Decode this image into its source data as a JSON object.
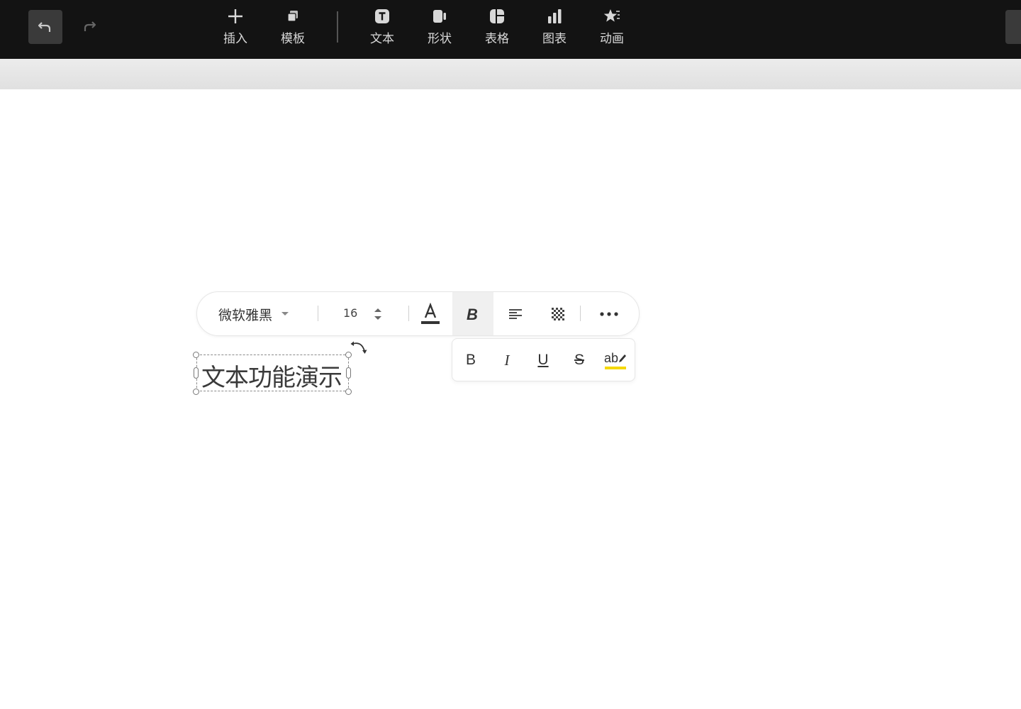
{
  "toolbar": {
    "undo_icon": "undo-arrow-icon",
    "redo_icon": "redo-arrow-icon",
    "tools": [
      {
        "label": "插入",
        "icon": "plus-icon"
      },
      {
        "label": "模板",
        "icon": "template-icon"
      },
      {
        "label": "文本",
        "icon": "text-box-icon"
      },
      {
        "label": "形状",
        "icon": "shape-icon"
      },
      {
        "label": "表格",
        "icon": "table-icon"
      },
      {
        "label": "图表",
        "icon": "bar-chart-icon"
      },
      {
        "label": "动画",
        "icon": "star-animation-icon"
      }
    ]
  },
  "format_bar": {
    "font_family": "微软雅黑",
    "font_size": "16",
    "font_color": "#333333",
    "buttons": [
      "font-color-icon",
      "bold-icon",
      "align-left-icon",
      "fill-pattern-icon",
      "more-icon"
    ],
    "active_button": "bold-icon"
  },
  "sub_bar": {
    "bold": "B",
    "italic": "I",
    "underline": "U",
    "strikethrough": "S",
    "highlight": "ab",
    "highlight_color": "#f5d800"
  },
  "canvas": {
    "text_box": "文本功能演示"
  },
  "colors": {
    "topbar_bg": "#131313",
    "toolbar_label": "#d8d8d8",
    "active_bg": "#f0f0f0"
  }
}
